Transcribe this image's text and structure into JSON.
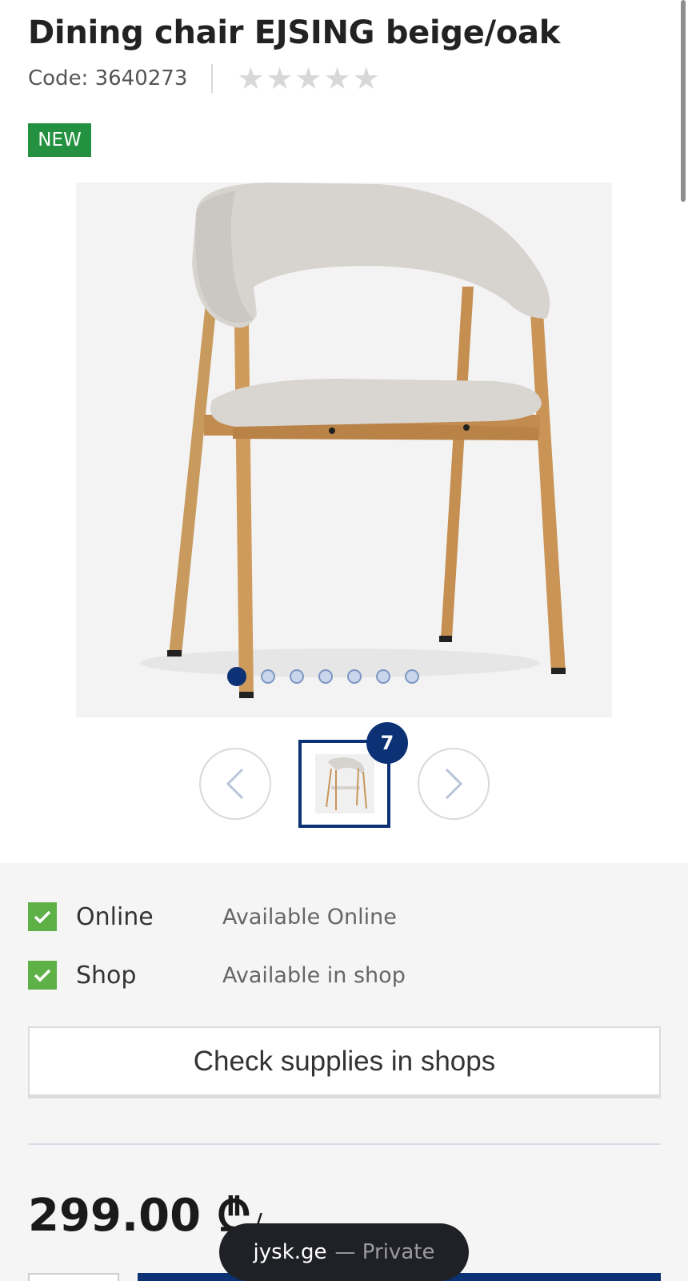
{
  "product": {
    "title": "Dining chair EJSING beige/oak",
    "code": "Code: 3640273",
    "rating_max": 5,
    "rating_value": 0,
    "badge": "NEW"
  },
  "gallery": {
    "image": "dining-chair-product-photo",
    "slide_count": 7,
    "active_slide": 1,
    "thumbnail_count": "7",
    "prev_icon": "chevron-left-icon",
    "next_icon": "chevron-right-icon"
  },
  "availability": [
    {
      "channel": "Online",
      "status": "Available Online"
    },
    {
      "channel": "Shop",
      "status": "Available in shop"
    }
  ],
  "actions": {
    "check_supplies": "Check supplies in shops"
  },
  "price": {
    "amount": "299.00 ₾",
    "suffix": "/"
  },
  "browser": {
    "domain": "jysk.ge",
    "mode": "— Private"
  },
  "colors": {
    "brand_blue": "#0c3275",
    "new_badge": "#23913f",
    "check_green": "#5db147"
  }
}
